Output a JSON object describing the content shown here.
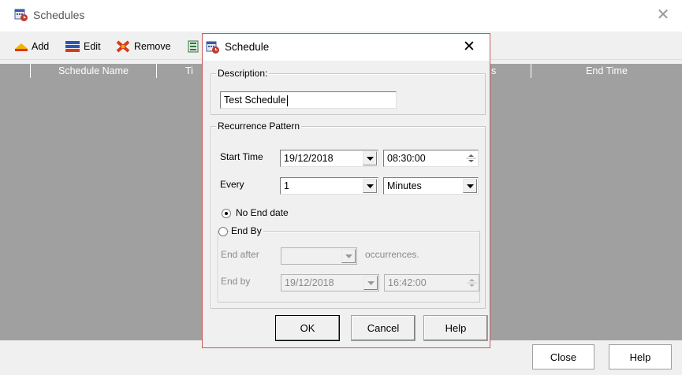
{
  "window": {
    "title": "Schedules",
    "close_glyph": "✕"
  },
  "toolbar": {
    "add_label": "Add",
    "edit_label": "Edit",
    "remove_label": "Remove"
  },
  "list": {
    "columns": [
      "Schedule Name",
      "Ti",
      "s",
      "End Time"
    ]
  },
  "bottom": {
    "close_label": "Close",
    "help_label": "Help"
  },
  "dialog": {
    "title": "Schedule",
    "close_glyph": "✕",
    "description": {
      "group_label": "Description:",
      "value": "Test Schedule"
    },
    "recurrence": {
      "group_label": "Recurrence Pattern",
      "start_time_label": "Start Time",
      "start_date": "19/12/2018",
      "start_clock": "08:30:00",
      "every_label": "Every",
      "every_value": "1",
      "every_unit": "Minutes",
      "no_end_label": "No End date",
      "no_end_selected": true,
      "end_by_group_label": "End By",
      "end_by_selected": false,
      "end_after_label": "End after",
      "end_after_value": "",
      "occurrences_label": "occurrences.",
      "end_by_label": "End by",
      "end_date": "19/12/2018",
      "end_clock": "16:42:00"
    },
    "ok_label": "OK",
    "cancel_label": "Cancel",
    "help_label": "Help"
  },
  "colors": {
    "list_background": "#a0a0a0",
    "dialog_border": "#c85a5a"
  },
  "icons": [
    "schedule-app-icon",
    "add-icon",
    "edit-icon",
    "remove-icon",
    "toolbar-extra-icon",
    "dropdown-arrow-icon",
    "spin-arrows-icon"
  ]
}
